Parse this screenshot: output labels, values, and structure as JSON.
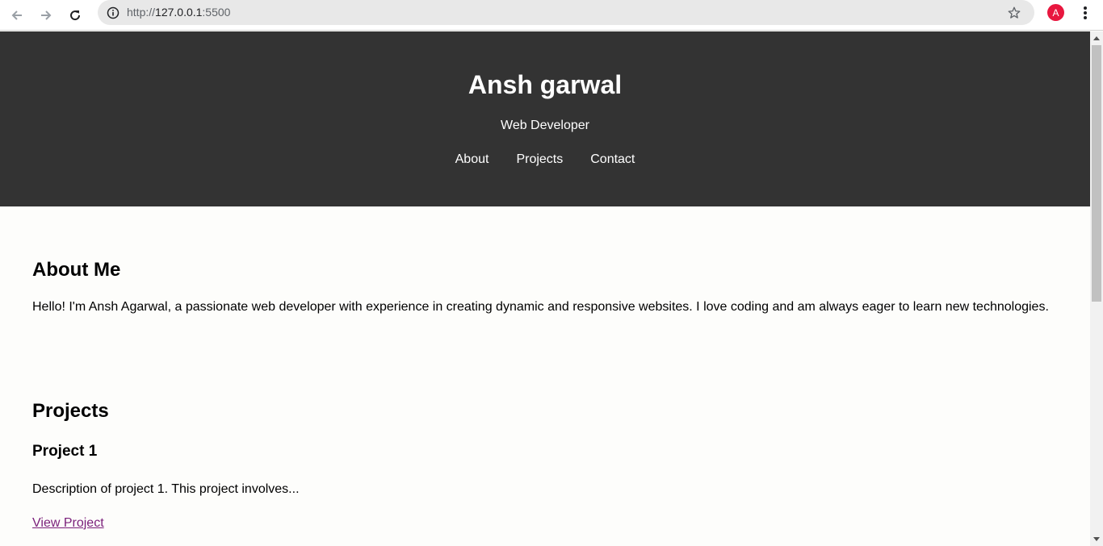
{
  "browser": {
    "url_scheme": "http://",
    "url_host": "127.0.0.1",
    "url_port": ":5500",
    "profile_initial": "A",
    "icons": [
      "back-icon",
      "forward-icon",
      "reload-icon",
      "info-icon",
      "star-icon",
      "menu-icon"
    ]
  },
  "header": {
    "title": "Ansh garwal",
    "subtitle": "Web Developer",
    "nav": [
      "About",
      "Projects",
      "Contact"
    ]
  },
  "about": {
    "heading": "About Me",
    "text": "Hello! I'm Ansh Agarwal, a passionate web developer with experience in creating dynamic and responsive websites. I love coding and am always eager to learn new technologies."
  },
  "projects": {
    "heading": "Projects",
    "items": [
      {
        "title": "Project 1",
        "description": "Description of project 1. This project involves...",
        "link_text": "View Project"
      }
    ]
  },
  "colors": {
    "header_bg": "#333333",
    "page_bg": "#fdfdfb",
    "visited_link": "#7a1f7a",
    "avatar_bg": "#e8173f"
  }
}
